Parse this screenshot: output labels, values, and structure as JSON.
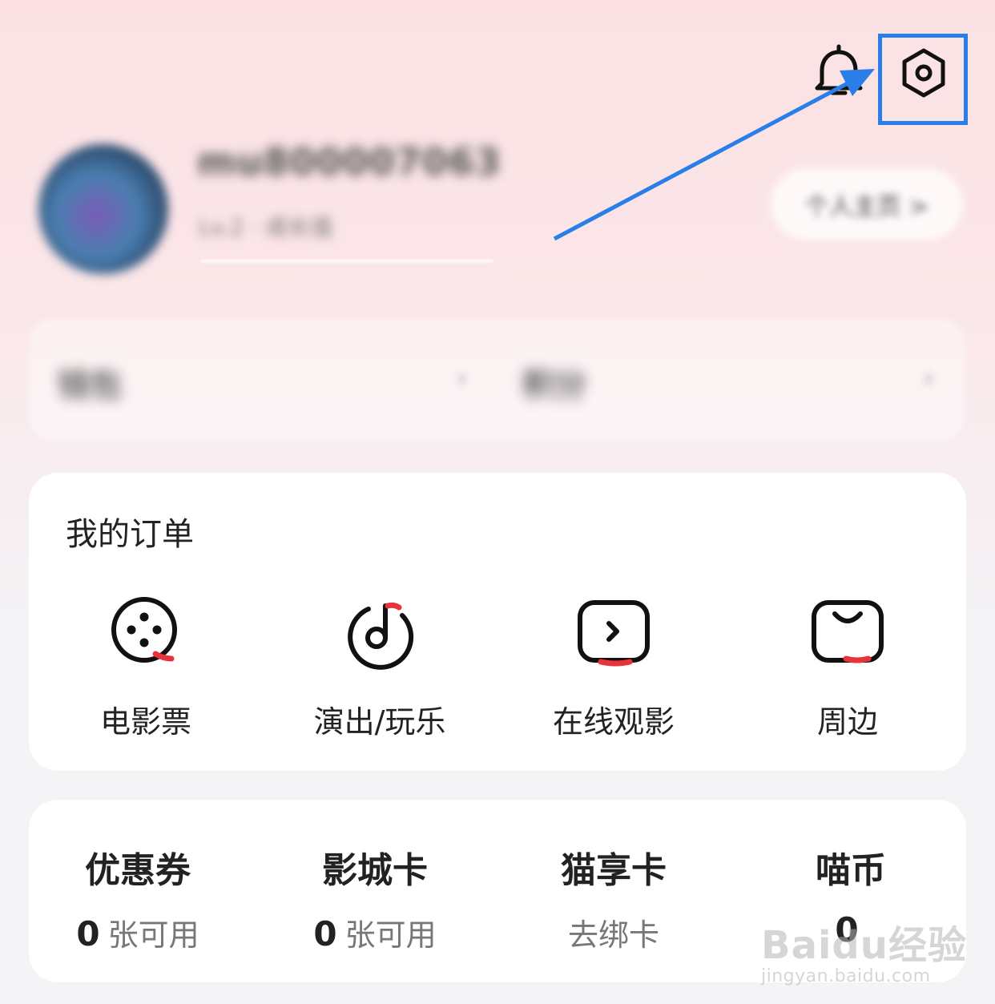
{
  "header": {
    "bell_icon": "bell-icon",
    "settings_icon": "hexagon-settings-icon"
  },
  "annotation": {
    "highlight_color": "#2a7ee8"
  },
  "profile": {
    "username": "mu800007063",
    "subtitle": "Lv.2 · 成长值",
    "home_button": "个人主页 >"
  },
  "blurred_row": {
    "left_label": "钱包",
    "right_label": "积分"
  },
  "orders": {
    "title": "我的订单",
    "items": [
      {
        "label": "电影票",
        "icon": "film-reel-icon"
      },
      {
        "label": "演出/玩乐",
        "icon": "music-note-icon"
      },
      {
        "label": "在线观影",
        "icon": "play-screen-icon"
      },
      {
        "label": "周边",
        "icon": "shopping-bag-icon"
      }
    ]
  },
  "assets": [
    {
      "title": "优惠券",
      "count": "0",
      "unit": "张可用"
    },
    {
      "title": "影城卡",
      "count": "0",
      "unit": "张可用"
    },
    {
      "title": "猫享卡",
      "count": "",
      "unit": "去绑卡"
    },
    {
      "title": "喵币",
      "count": "0",
      "unit": ""
    }
  ],
  "watermark": {
    "main": "Baidu经验",
    "sub": "jingyan.baidu.com"
  }
}
